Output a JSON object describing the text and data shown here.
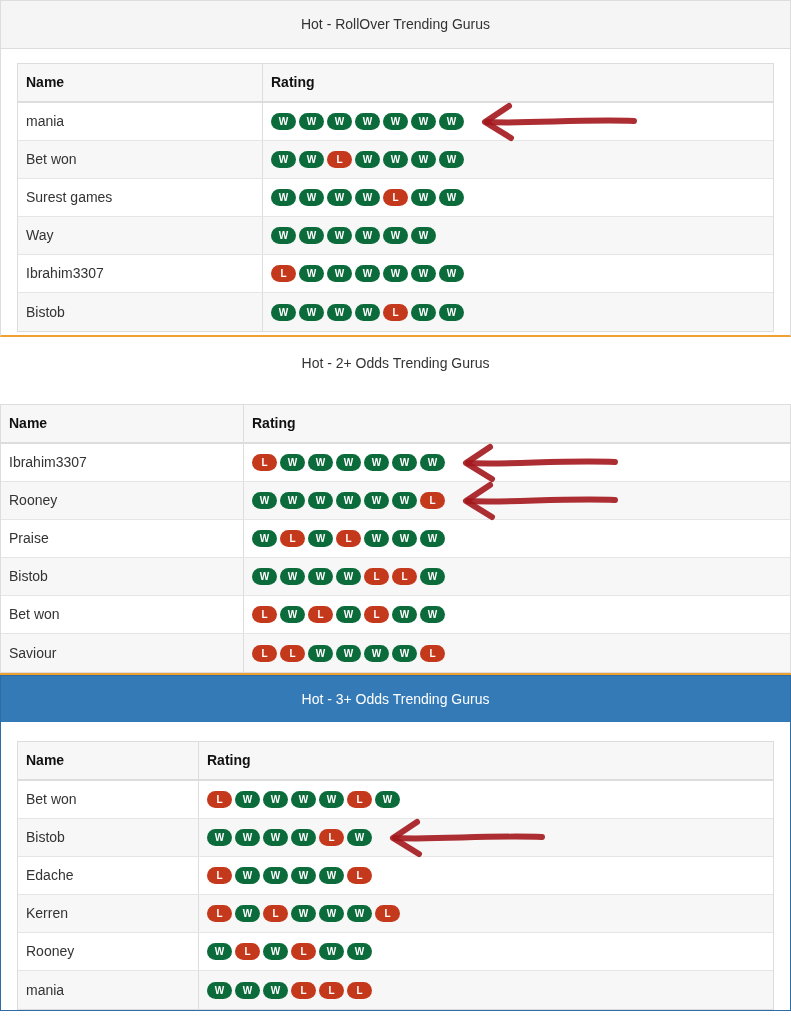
{
  "panels": [
    {
      "title": "Hot - RollOver Trending Gurus",
      "kind": "plain",
      "columns": [
        "Name",
        "Rating"
      ],
      "rows": [
        {
          "name": "mania",
          "arrow": true,
          "rating": [
            {
              "label": "W",
              "kind": "win"
            },
            {
              "label": "W",
              "kind": "win"
            },
            {
              "label": "W",
              "kind": "win"
            },
            {
              "label": "W",
              "kind": "win"
            },
            {
              "label": "W",
              "kind": "win"
            },
            {
              "label": "W",
              "kind": "win"
            },
            {
              "label": "W",
              "kind": "win"
            }
          ]
        },
        {
          "name": "Bet won",
          "arrow": false,
          "rating": [
            {
              "label": "W",
              "kind": "win"
            },
            {
              "label": "W",
              "kind": "win"
            },
            {
              "label": "L",
              "kind": "loss"
            },
            {
              "label": "W",
              "kind": "win"
            },
            {
              "label": "W",
              "kind": "win"
            },
            {
              "label": "W",
              "kind": "win"
            },
            {
              "label": "W",
              "kind": "win"
            }
          ]
        },
        {
          "name": "Surest games",
          "arrow": false,
          "rating": [
            {
              "label": "W",
              "kind": "win"
            },
            {
              "label": "W",
              "kind": "win"
            },
            {
              "label": "W",
              "kind": "win"
            },
            {
              "label": "W",
              "kind": "win"
            },
            {
              "label": "L",
              "kind": "loss"
            },
            {
              "label": "W",
              "kind": "win"
            },
            {
              "label": "W",
              "kind": "win"
            }
          ]
        },
        {
          "name": "Way",
          "arrow": false,
          "rating": [
            {
              "label": "W",
              "kind": "win"
            },
            {
              "label": "W",
              "kind": "win"
            },
            {
              "label": "W",
              "kind": "win"
            },
            {
              "label": "W",
              "kind": "win"
            },
            {
              "label": "W",
              "kind": "win"
            },
            {
              "label": "W",
              "kind": "win"
            }
          ]
        },
        {
          "name": "Ibrahim3307",
          "arrow": false,
          "rating": [
            {
              "label": "L",
              "kind": "loss"
            },
            {
              "label": "W",
              "kind": "win"
            },
            {
              "label": "W",
              "kind": "win"
            },
            {
              "label": "W",
              "kind": "win"
            },
            {
              "label": "W",
              "kind": "win"
            },
            {
              "label": "W",
              "kind": "win"
            },
            {
              "label": "W",
              "kind": "win"
            }
          ]
        },
        {
          "name": "Bistob",
          "arrow": false,
          "rating": [
            {
              "label": "W",
              "kind": "win"
            },
            {
              "label": "W",
              "kind": "win"
            },
            {
              "label": "W",
              "kind": "win"
            },
            {
              "label": "W",
              "kind": "win"
            },
            {
              "label": "L",
              "kind": "loss"
            },
            {
              "label": "W",
              "kind": "win"
            },
            {
              "label": "W",
              "kind": "win"
            }
          ]
        }
      ]
    },
    {
      "title": "Hot - 2+ Odds Trending Gurus",
      "kind": "bare",
      "columns": [
        "Name",
        "Rating"
      ],
      "rows": [
        {
          "name": "Ibrahim3307",
          "arrow": true,
          "rating": [
            {
              "label": "L",
              "kind": "loss"
            },
            {
              "label": "W",
              "kind": "win"
            },
            {
              "label": "W",
              "kind": "win"
            },
            {
              "label": "W",
              "kind": "win"
            },
            {
              "label": "W",
              "kind": "win"
            },
            {
              "label": "W",
              "kind": "win"
            },
            {
              "label": "W",
              "kind": "win"
            }
          ]
        },
        {
          "name": "Rooney",
          "arrow": true,
          "rating": [
            {
              "label": "W",
              "kind": "win"
            },
            {
              "label": "W",
              "kind": "win"
            },
            {
              "label": "W",
              "kind": "win"
            },
            {
              "label": "W",
              "kind": "win"
            },
            {
              "label": "W",
              "kind": "win"
            },
            {
              "label": "W",
              "kind": "win"
            },
            {
              "label": "L",
              "kind": "loss"
            }
          ]
        },
        {
          "name": "Praise",
          "arrow": false,
          "rating": [
            {
              "label": "W",
              "kind": "win"
            },
            {
              "label": "L",
              "kind": "loss"
            },
            {
              "label": "W",
              "kind": "win"
            },
            {
              "label": "L",
              "kind": "loss"
            },
            {
              "label": "W",
              "kind": "win"
            },
            {
              "label": "W",
              "kind": "win"
            },
            {
              "label": "W",
              "kind": "win"
            }
          ]
        },
        {
          "name": "Bistob",
          "arrow": false,
          "rating": [
            {
              "label": "W",
              "kind": "win"
            },
            {
              "label": "W",
              "kind": "win"
            },
            {
              "label": "W",
              "kind": "win"
            },
            {
              "label": "W",
              "kind": "win"
            },
            {
              "label": "L",
              "kind": "loss"
            },
            {
              "label": "L",
              "kind": "loss"
            },
            {
              "label": "W",
              "kind": "win"
            }
          ]
        },
        {
          "name": "Bet won",
          "arrow": false,
          "rating": [
            {
              "label": "L",
              "kind": "loss"
            },
            {
              "label": "W",
              "kind": "win"
            },
            {
              "label": "L",
              "kind": "loss"
            },
            {
              "label": "W",
              "kind": "win"
            },
            {
              "label": "L",
              "kind": "loss"
            },
            {
              "label": "W",
              "kind": "win"
            },
            {
              "label": "W",
              "kind": "win"
            }
          ]
        },
        {
          "name": "Saviour",
          "arrow": false,
          "rating": [
            {
              "label": "L",
              "kind": "loss"
            },
            {
              "label": "L",
              "kind": "loss"
            },
            {
              "label": "W",
              "kind": "win"
            },
            {
              "label": "W",
              "kind": "win"
            },
            {
              "label": "W",
              "kind": "win"
            },
            {
              "label": "W",
              "kind": "win"
            },
            {
              "label": "L",
              "kind": "loss"
            }
          ]
        }
      ]
    },
    {
      "title": "Hot - 3+ Odds Trending Gurus",
      "kind": "primary",
      "columns": [
        "Name",
        "Rating"
      ],
      "rows": [
        {
          "name": "Bet won",
          "arrow": false,
          "rating": [
            {
              "label": "L",
              "kind": "loss"
            },
            {
              "label": "W",
              "kind": "win"
            },
            {
              "label": "W",
              "kind": "win"
            },
            {
              "label": "W",
              "kind": "win"
            },
            {
              "label": "W",
              "kind": "win"
            },
            {
              "label": "L",
              "kind": "loss"
            },
            {
              "label": "W",
              "kind": "win"
            }
          ]
        },
        {
          "name": "Bistob",
          "arrow": true,
          "rating": [
            {
              "label": "W",
              "kind": "win"
            },
            {
              "label": "W",
              "kind": "win"
            },
            {
              "label": "W",
              "kind": "win"
            },
            {
              "label": "W",
              "kind": "win"
            },
            {
              "label": "L",
              "kind": "loss"
            },
            {
              "label": "W",
              "kind": "win"
            }
          ]
        },
        {
          "name": "Edache",
          "arrow": false,
          "rating": [
            {
              "label": "L",
              "kind": "loss"
            },
            {
              "label": "W",
              "kind": "win"
            },
            {
              "label": "W",
              "kind": "win"
            },
            {
              "label": "W",
              "kind": "win"
            },
            {
              "label": "W",
              "kind": "win"
            },
            {
              "label": "L",
              "kind": "loss"
            }
          ]
        },
        {
          "name": "Kerren",
          "arrow": false,
          "rating": [
            {
              "label": "L",
              "kind": "loss"
            },
            {
              "label": "W",
              "kind": "win"
            },
            {
              "label": "L",
              "kind": "loss"
            },
            {
              "label": "W",
              "kind": "win"
            },
            {
              "label": "W",
              "kind": "win"
            },
            {
              "label": "W",
              "kind": "win"
            },
            {
              "label": "L",
              "kind": "loss"
            }
          ]
        },
        {
          "name": "Rooney",
          "arrow": false,
          "rating": [
            {
              "label": "W",
              "kind": "win"
            },
            {
              "label": "L",
              "kind": "loss"
            },
            {
              "label": "W",
              "kind": "win"
            },
            {
              "label": "L",
              "kind": "loss"
            },
            {
              "label": "W",
              "kind": "win"
            },
            {
              "label": "W",
              "kind": "win"
            }
          ]
        },
        {
          "name": "mania",
          "arrow": false,
          "rating": [
            {
              "label": "W",
              "kind": "win"
            },
            {
              "label": "W",
              "kind": "win"
            },
            {
              "label": "W",
              "kind": "win"
            },
            {
              "label": "L",
              "kind": "loss"
            },
            {
              "label": "L",
              "kind": "loss"
            },
            {
              "label": "L",
              "kind": "loss"
            }
          ]
        }
      ]
    }
  ]
}
